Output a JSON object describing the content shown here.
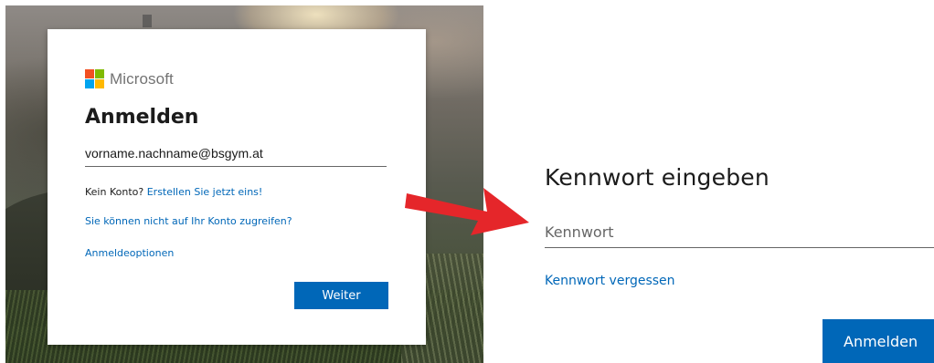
{
  "left_panel": {
    "logo": {
      "text": "Microsoft",
      "squares": [
        "#f25022",
        "#7fba00",
        "#00a4ef",
        "#ffb900"
      ]
    },
    "title": "Anmelden",
    "email_value": "vorname.nachname@bsgym.at",
    "no_account_text": "Kein Konto?",
    "create_link": "Erstellen Sie jetzt eins!",
    "cant_access_link": "Sie können nicht auf Ihr Konto zugreifen?",
    "signin_options_link": "Anmeldeoptionen",
    "next_button": "Weiter"
  },
  "right_panel": {
    "title": "Kennwort eingeben",
    "password_placeholder": "Kennwort",
    "forgot_link": "Kennwort vergessen",
    "signin_button": "Anmelden"
  },
  "colors": {
    "accent": "#0067b8",
    "arrow": "#e5262a"
  }
}
